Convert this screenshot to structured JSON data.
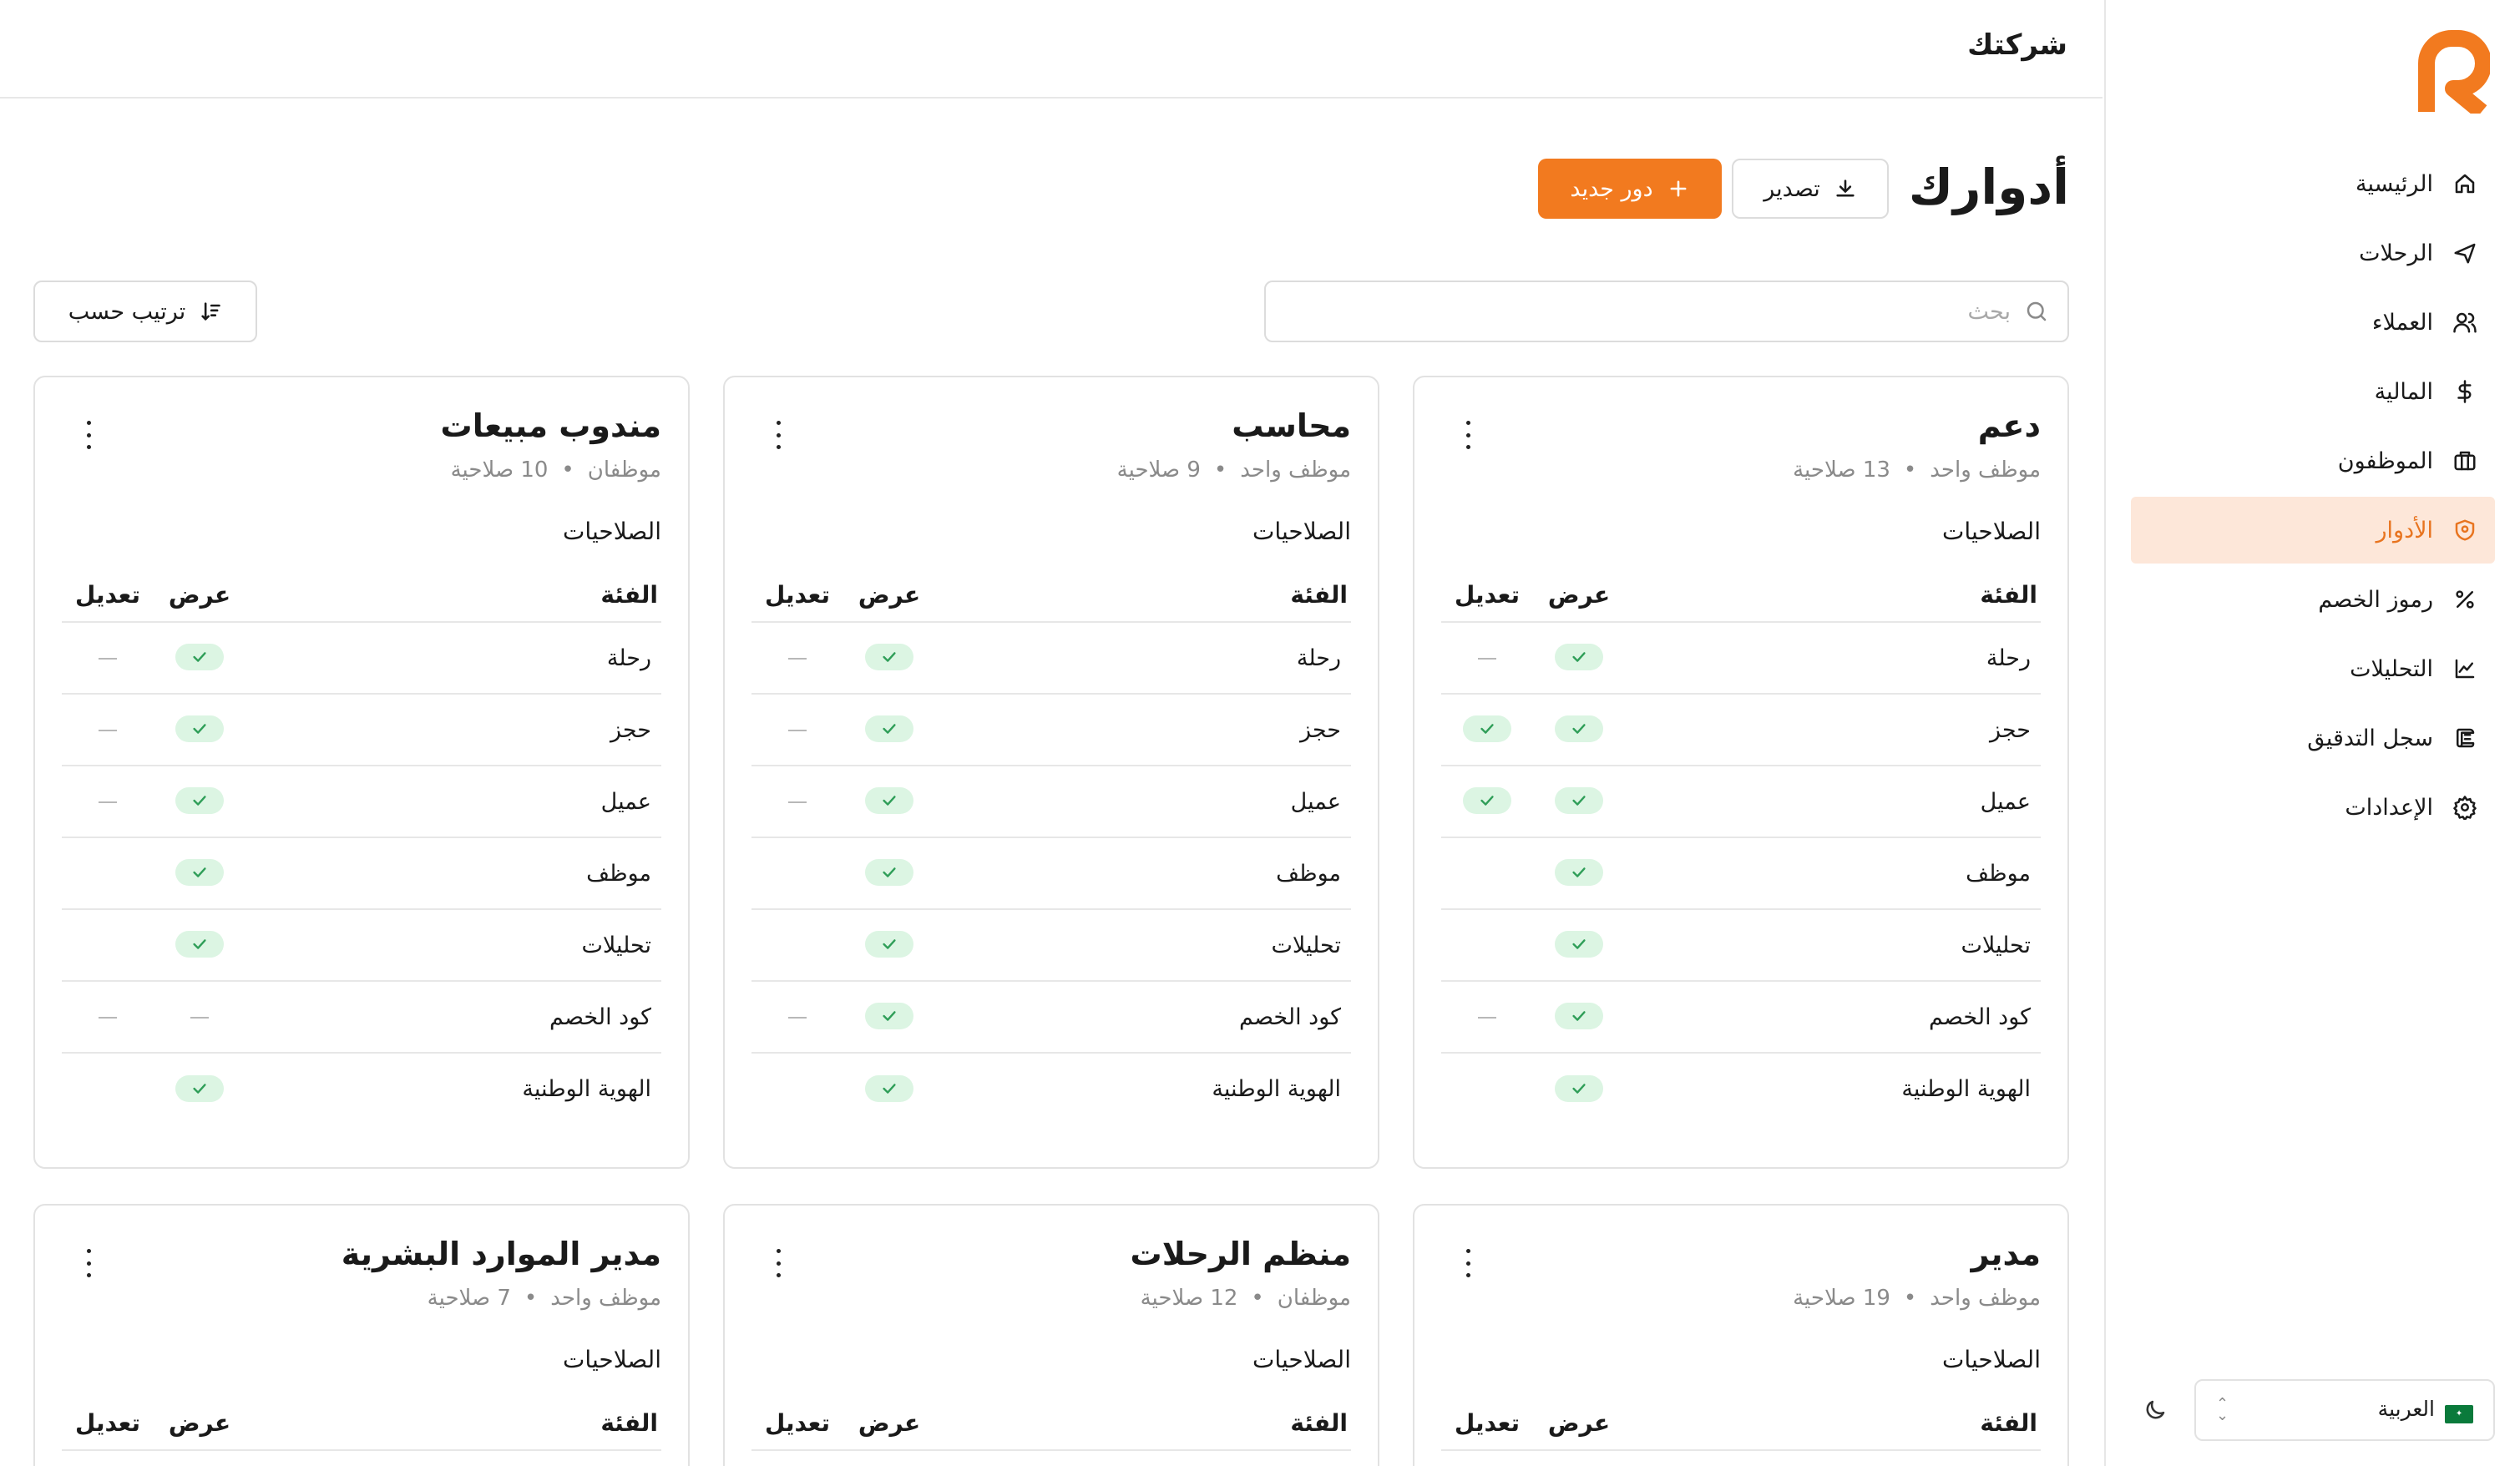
{
  "company_name": "شركتك",
  "page_title": "أدوارك",
  "buttons": {
    "new_role": "دور جديد",
    "export": "تصدير",
    "sort": "ترتيب حسب"
  },
  "search": {
    "placeholder": "بحث"
  },
  "sidebar": {
    "items": [
      {
        "label": "الرئيسية",
        "icon": "home-icon",
        "active": false
      },
      {
        "label": "الرحلات",
        "icon": "plane-icon",
        "active": false
      },
      {
        "label": "العملاء",
        "icon": "users-icon",
        "active": false
      },
      {
        "label": "المالية",
        "icon": "dollar-icon",
        "active": false
      },
      {
        "label": "الموظفون",
        "icon": "briefcase-icon",
        "active": false
      },
      {
        "label": "الأدوار",
        "icon": "shield-icon",
        "active": true
      },
      {
        "label": "رموز الخصم",
        "icon": "percent-icon",
        "active": false
      },
      {
        "label": "التحليلات",
        "icon": "chart-icon",
        "active": false
      },
      {
        "label": "سجل التدقيق",
        "icon": "scroll-icon",
        "active": false
      },
      {
        "label": "الإعدادات",
        "icon": "gear-icon",
        "active": false
      }
    ],
    "language": "العربية"
  },
  "colors": {
    "accent": "#f27a1f",
    "active_bg": "#fde7d9",
    "check_bg": "#dcf5e3",
    "check": "#2f9e58"
  },
  "table_headers": {
    "category": "الفئة",
    "view": "عرض",
    "edit": "تعديل"
  },
  "permissions_label": "الصلاحيات",
  "roles": [
    {
      "name": "دعم",
      "employees": "موظف واحد",
      "permissions_count": "13 صلاحية",
      "rows": [
        {
          "category": "رحلة",
          "view": "check",
          "edit": "dash"
        },
        {
          "category": "حجز",
          "view": "check",
          "edit": "check"
        },
        {
          "category": "عميل",
          "view": "check",
          "edit": "check"
        },
        {
          "category": "موظف",
          "view": "check",
          "edit": "none"
        },
        {
          "category": "تحليلات",
          "view": "check",
          "edit": "none"
        },
        {
          "category": "كود الخصم",
          "view": "check",
          "edit": "dash"
        },
        {
          "category": "الهوية الوطنية",
          "view": "check",
          "edit": "none"
        }
      ]
    },
    {
      "name": "محاسب",
      "employees": "موظف واحد",
      "permissions_count": "9 صلاحية",
      "rows": [
        {
          "category": "رحلة",
          "view": "check",
          "edit": "dash"
        },
        {
          "category": "حجز",
          "view": "check",
          "edit": "dash"
        },
        {
          "category": "عميل",
          "view": "check",
          "edit": "dash"
        },
        {
          "category": "موظف",
          "view": "check",
          "edit": "none"
        },
        {
          "category": "تحليلات",
          "view": "check",
          "edit": "none"
        },
        {
          "category": "كود الخصم",
          "view": "check",
          "edit": "dash"
        },
        {
          "category": "الهوية الوطنية",
          "view": "check",
          "edit": "none"
        }
      ]
    },
    {
      "name": "مندوب مبيعات",
      "employees": "موظفان",
      "permissions_count": "10 صلاحية",
      "rows": [
        {
          "category": "رحلة",
          "view": "check",
          "edit": "dash"
        },
        {
          "category": "حجز",
          "view": "check",
          "edit": "dash"
        },
        {
          "category": "عميل",
          "view": "check",
          "edit": "dash"
        },
        {
          "category": "موظف",
          "view": "check",
          "edit": "none"
        },
        {
          "category": "تحليلات",
          "view": "check",
          "edit": "none"
        },
        {
          "category": "كود الخصم",
          "view": "dash",
          "edit": "dash"
        },
        {
          "category": "الهوية الوطنية",
          "view": "check",
          "edit": "none"
        }
      ]
    },
    {
      "name": "مدير",
      "employees": "موظف واحد",
      "permissions_count": "19 صلاحية",
      "rows": []
    },
    {
      "name": "منظم الرحلات",
      "employees": "موظفان",
      "permissions_count": "12 صلاحية",
      "rows": []
    },
    {
      "name": "مدير الموارد البشرية",
      "employees": "موظف واحد",
      "permissions_count": "7 صلاحية",
      "rows": []
    }
  ]
}
